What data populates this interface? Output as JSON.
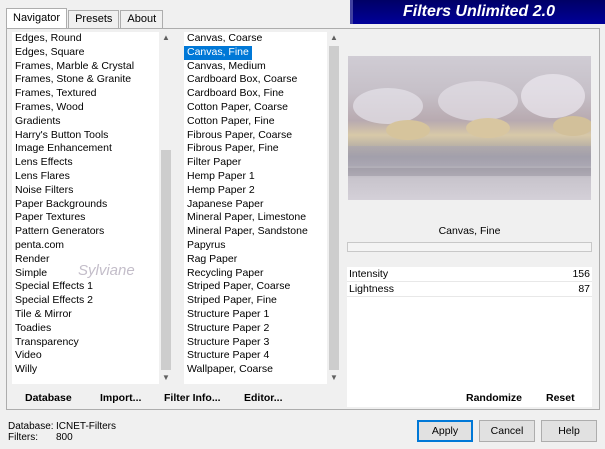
{
  "tabs": [
    "Navigator",
    "Presets",
    "About"
  ],
  "banner": "Filters Unlimited 2.0",
  "categories": [
    "Edges, Round",
    "Edges, Square",
    "Frames, Marble & Crystal",
    "Frames, Stone & Granite",
    "Frames, Textured",
    "Frames, Wood",
    "Gradients",
    "Harry's Button Tools",
    "Image Enhancement",
    "Lens Effects",
    "Lens Flares",
    "Noise Filters",
    "Paper Backgrounds",
    "Paper Textures",
    "Pattern Generators",
    "penta.com",
    "Render",
    "Simple",
    "Special Effects 1",
    "Special Effects 2",
    "Tile & Mirror",
    "Toadies",
    "Transparency",
    "Video",
    "Willy"
  ],
  "filters": [
    "Canvas, Coarse",
    "Canvas, Fine",
    "Canvas, Medium",
    "Cardboard Box, Coarse",
    "Cardboard Box, Fine",
    "Cotton Paper, Coarse",
    "Cotton Paper, Fine",
    "Fibrous Paper, Coarse",
    "Fibrous Paper, Fine",
    "Filter Paper",
    "Hemp Paper 1",
    "Hemp Paper 2",
    "Japanese Paper",
    "Mineral Paper, Limestone",
    "Mineral Paper, Sandstone",
    "Papyrus",
    "Rag Paper",
    "Recycling Paper",
    "Striped Paper, Coarse",
    "Striped Paper, Fine",
    "Structure Paper 1",
    "Structure Paper 2",
    "Structure Paper 3",
    "Structure Paper 4",
    "Wallpaper, Coarse"
  ],
  "selected_filter_index": 1,
  "current_filter": "Canvas, Fine",
  "params": [
    {
      "label": "Intensity",
      "value": "156"
    },
    {
      "label": "Lightness",
      "value": "87"
    }
  ],
  "toolbar": {
    "database": "Database",
    "import": "Import...",
    "filter_info": "Filter Info...",
    "editor": "Editor...",
    "randomize": "Randomize",
    "reset": "Reset"
  },
  "info": {
    "database_label": "Database:",
    "database_value": "ICNET-Filters",
    "filters_label": "Filters:",
    "filters_value": "800"
  },
  "buttons": {
    "apply": "Apply",
    "cancel": "Cancel",
    "help": "Help"
  },
  "watermark": "Sylviane"
}
